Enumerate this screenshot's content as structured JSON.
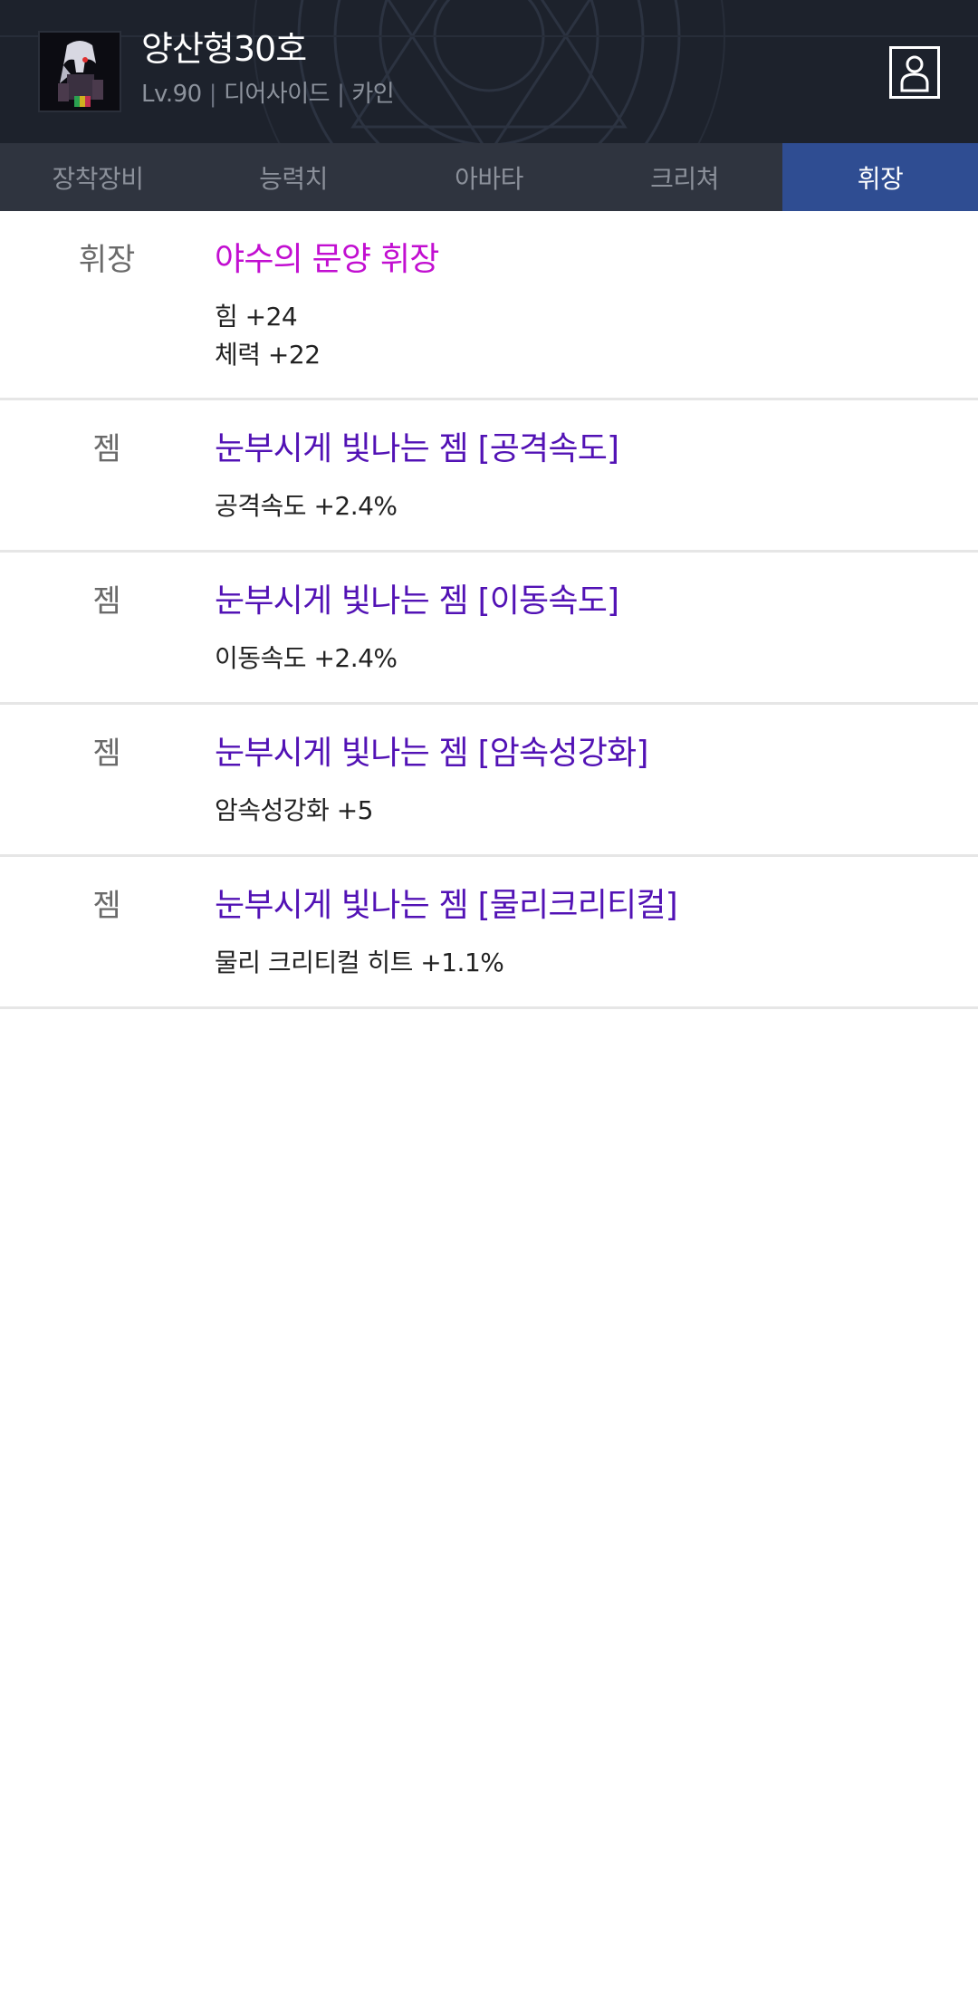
{
  "header": {
    "character_name": "양산형30호",
    "level": "Lv.90",
    "job": "디어사이드",
    "server": "카인",
    "separator": "|"
  },
  "tabs": [
    {
      "label": "장착장비",
      "active": false
    },
    {
      "label": "능력치",
      "active": false
    },
    {
      "label": "아바타",
      "active": false
    },
    {
      "label": "크리쳐",
      "active": false
    },
    {
      "label": "휘장",
      "active": true
    }
  ],
  "emblem_rows": [
    {
      "slot": "휘장",
      "name": "야수의 문양 휘장",
      "stats": [
        "힘 +24",
        "체력 +22"
      ]
    },
    {
      "slot": "젬",
      "name": "눈부시게 빛나는 젬 [공격속도]",
      "stats": [
        "공격속도 +2.4%"
      ]
    },
    {
      "slot": "젬",
      "name": "눈부시게 빛나는 젬 [이동속도]",
      "stats": [
        "이동속도 +2.4%"
      ]
    },
    {
      "slot": "젬",
      "name": "눈부시게 빛나는 젬 [암속성강화]",
      "stats": [
        "암속성강화 +5"
      ]
    },
    {
      "slot": "젬",
      "name": "눈부시게 빛나는 젬 [물리크리티컬]",
      "stats": [
        "물리 크리티컬 히트 +1.1%"
      ]
    }
  ],
  "colors": {
    "header_bg": "#1d222c",
    "tab_bar_bg": "#2f343f",
    "tab_active_bg": "#2f4d92",
    "emblem_name": "#c20fd1",
    "gem_name": "#5212b5"
  },
  "icons": {
    "profile": "person-outline-icon",
    "avatar": "character-portrait"
  }
}
